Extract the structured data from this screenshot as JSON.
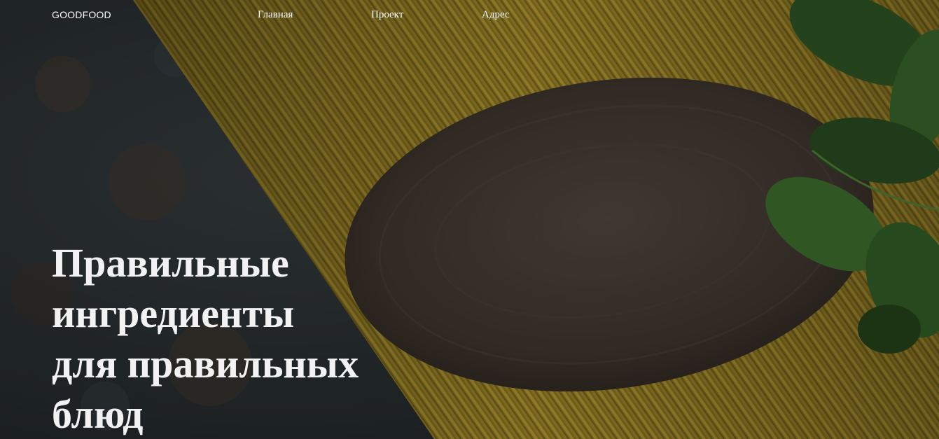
{
  "header": {
    "logo": "GOODFOOD",
    "nav": {
      "home": "Главная",
      "project": "Проект",
      "address": "Адрес"
    }
  },
  "hero": {
    "headline_lines": [
      "Правильные",
      "ингредиенты",
      "для правильных",
      "блюд"
    ],
    "background": "dark stone surface with raw spaghetti, wooden spoon and basil leaves"
  },
  "colors": {
    "text": "#ffffff",
    "headline": "#f2f2f2",
    "stone": "#2a3033",
    "pasta": "#b89a2e",
    "spoon": "#4a4038",
    "basil": "#2f5a25"
  }
}
